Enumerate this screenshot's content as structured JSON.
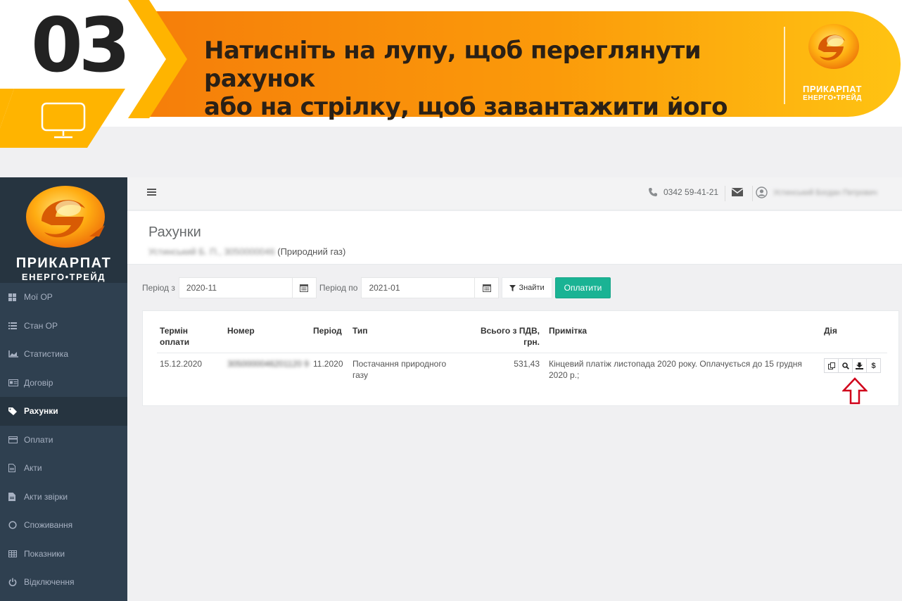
{
  "banner": {
    "step_number": "03",
    "instruction_line1": "Натисніть на лупу, щоб переглянути рахунок",
    "instruction_line2": "або на стрілку, щоб завантажити його",
    "brand_name_line1": "ПРИКАРПАТ",
    "brand_name_line2": "ЕНЕРГО•ТРЕЙД",
    "icon": "monitor-icon",
    "colors": {
      "orange_start": "#f57c0a",
      "orange_end": "#ffc312",
      "yellow_accent": "#ffb400"
    }
  },
  "sidebar": {
    "logo_line1": "ПРИКАРПАТ",
    "logo_line2": "ЕНЕРГО•ТРЕЙД",
    "items": [
      {
        "label": "Мої ОР",
        "icon": "grid-icon",
        "active": false
      },
      {
        "label": "Стан ОР",
        "icon": "list-icon",
        "active": false
      },
      {
        "label": "Статистика",
        "icon": "chart-icon",
        "active": false
      },
      {
        "label": "Договір",
        "icon": "id-card-icon",
        "active": false
      },
      {
        "label": "Рахунки",
        "icon": "tags-icon",
        "active": true
      },
      {
        "label": "Оплати",
        "icon": "credit-card-icon",
        "active": false
      },
      {
        "label": "Акти",
        "icon": "file-icon",
        "active": false
      },
      {
        "label": "Акти звірки",
        "icon": "file-text-icon",
        "active": false
      },
      {
        "label": "Споживання",
        "icon": "circle-icon",
        "active": false
      },
      {
        "label": "Показники",
        "icon": "table-icon",
        "active": false
      },
      {
        "label": "Відключення",
        "icon": "power-icon",
        "active": false
      }
    ],
    "colors": {
      "background": "#2f4050",
      "active": "#263440"
    }
  },
  "topbar": {
    "phone": "0342 59-41-21",
    "user_name": "Устинський Богдан Петрович"
  },
  "heading": {
    "title": "Рахунки",
    "account_blurred": "Устинський Б. П., 3050000046",
    "account_type": "(Природний газ)"
  },
  "filter": {
    "period_from_label": "Період з",
    "period_from_value": "2020-11",
    "period_to_label": "Період по",
    "period_to_value": "2021-01",
    "find_label": "Знайти",
    "pay_label": "Оплатити",
    "pay_color": "#1ab394"
  },
  "table": {
    "headers": {
      "due_line1": "Термін",
      "due_line2": "оплати",
      "number": "Номер",
      "period": "Період",
      "type": "Тип",
      "total_line1": "Всього з ПДВ,",
      "total_line2": "грн.",
      "note": "Примітка",
      "action": "Дія"
    },
    "rows": [
      {
        "due": "15.12.2020",
        "number": "3050000046201120 9",
        "period": "11.2020",
        "type_line1": "Постачання природного",
        "type_line2": "газу",
        "total": "531,43",
        "note_line1": "Кінцевий платіж листопада 2020 року. Оплачується до 15 грудня",
        "note_line2": "2020 р.;",
        "actions": [
          "copy-icon",
          "search-icon",
          "download-icon",
          "dollar-icon"
        ],
        "dollar_label": "$"
      }
    ],
    "highlight_color": "#d0021b"
  }
}
